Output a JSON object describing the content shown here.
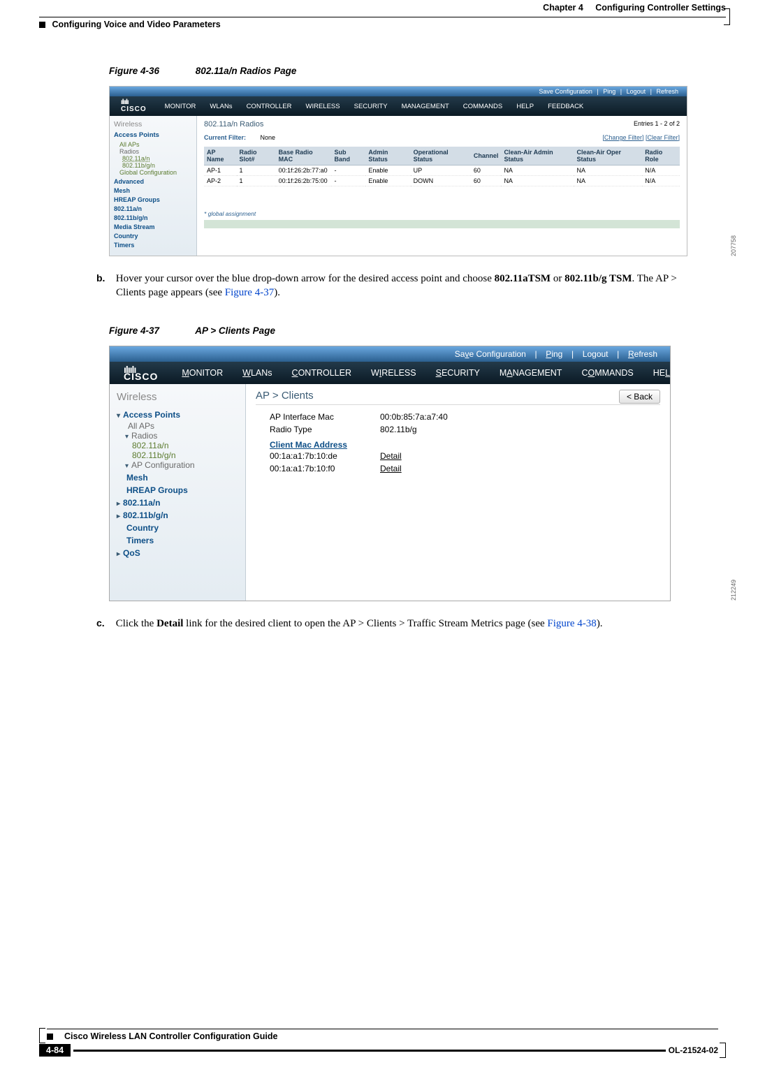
{
  "header": {
    "chapter_label": "Chapter 4",
    "chapter_title": "Configuring Controller Settings",
    "section": "Configuring Voice and Video Parameters"
  },
  "fig36": {
    "caption_num": "Figure 4-36",
    "caption_title": "802.11a/n Radios Page",
    "side_id": "207758",
    "topbar": {
      "save": "Save Configuration",
      "ping": "Ping",
      "logout": "Logout",
      "refresh": "Refresh"
    },
    "brand_bars": "ılıılı",
    "brand": "CISCO",
    "menu": [
      "MONITOR",
      "WLANs",
      "CONTROLLER",
      "WIRELESS",
      "SECURITY",
      "MANAGEMENT",
      "COMMANDS",
      "HELP",
      "FEEDBACK"
    ],
    "side": {
      "hdr": "Wireless",
      "ap": "Access Points",
      "all_aps": "All APs",
      "radios": "Radios",
      "r1": "802.11a/n",
      "r2": "802.11b/g/n",
      "gcfg": "Global Configuration",
      "adv": "Advanced",
      "mesh": "Mesh",
      "hreap": "HREAP Groups",
      "an": "802.11a/n",
      "bgn": "802.11b/g/n",
      "media": "Media Stream",
      "country": "Country",
      "timers": "Timers"
    },
    "page_title": "802.11a/n Radios",
    "entries": "Entries 1 - 2 of 2",
    "filter_lbl": "Current Filter:",
    "filter_val": "None",
    "change_filter": "Change Filter",
    "clear_filter": "Clear Filter",
    "cols": [
      "AP Name",
      "Radio Slot#",
      "Base Radio MAC",
      "Sub Band",
      "Admin Status",
      "Operational Status",
      "Channel",
      "Clean-Air Admin Status",
      "Clean-Air Oper Status",
      "Radio Role"
    ],
    "rows": [
      [
        "AP-1",
        "1",
        "00:1f:26:2b:77:a0",
        "-",
        "Enable",
        "UP",
        "60",
        "NA",
        "NA",
        "N/A"
      ],
      [
        "AP-2",
        "1",
        "00:1f:26:2b:75:00",
        "-",
        "Enable",
        "DOWN",
        "60",
        "NA",
        "NA",
        "N/A"
      ]
    ],
    "ga": "* global assignment"
  },
  "step_b": {
    "label": "b.",
    "text1": "Hover your cursor over the blue drop-down arrow for the desired access point and choose ",
    "bold1": "802.11aTSM",
    "text2": " or ",
    "bold2": "802.11b/g TSM",
    "text3": ". The AP > Clients page appears (see ",
    "link": "Figure 4-37",
    "text4": ")."
  },
  "fig37": {
    "caption_num": "Figure 4-37",
    "caption_title": "AP > Clients Page",
    "side_id": "212249",
    "topbar": {
      "save": "Save Configuration",
      "ping": "Ping",
      "logout": "Logout",
      "refresh": "Refresh"
    },
    "brand_bars": "ılıılı",
    "brand": "CISCO",
    "menu": [
      "MONITOR",
      "WLANs",
      "CONTROLLER",
      "WIRELESS",
      "SECURITY",
      "MANAGEMENT",
      "COMMANDS",
      "HELP"
    ],
    "side": {
      "hdr": "Wireless",
      "ap": "Access Points",
      "all_aps": "All APs",
      "radios": "Radios",
      "r1": "802.11a/n",
      "r2": "802.11b/g/n",
      "apcfg": "AP Configuration",
      "mesh": "Mesh",
      "hreap": "HREAP Groups",
      "an": "802.11a/n",
      "bgn": "802.11b/g/n",
      "country": "Country",
      "timers": "Timers",
      "qos": "QoS"
    },
    "page_title": "AP > Clients",
    "back": "< Back",
    "kv": [
      {
        "k": "AP Interface Mac",
        "v": "00:0b:85:7a:a7:40"
      },
      {
        "k": "Radio Type",
        "v": "802.11b/g"
      }
    ],
    "cma_hdr": "Client Mac Address",
    "clients": [
      {
        "mac": "00:1a:a1:7b:10:de",
        "link": "Detail"
      },
      {
        "mac": "00:1a:a1:7b:10:f0",
        "link": "Detail"
      }
    ]
  },
  "step_c": {
    "label": "c.",
    "text1": "Click the ",
    "bold1": "Detail",
    "text2": " link for the desired client to open the AP > Clients > Traffic Stream Metrics page (see ",
    "link": "Figure 4-38",
    "text3": ")."
  },
  "footer": {
    "title": "Cisco Wireless LAN Controller Configuration Guide",
    "page": "4-84",
    "ol": "OL-21524-02"
  }
}
